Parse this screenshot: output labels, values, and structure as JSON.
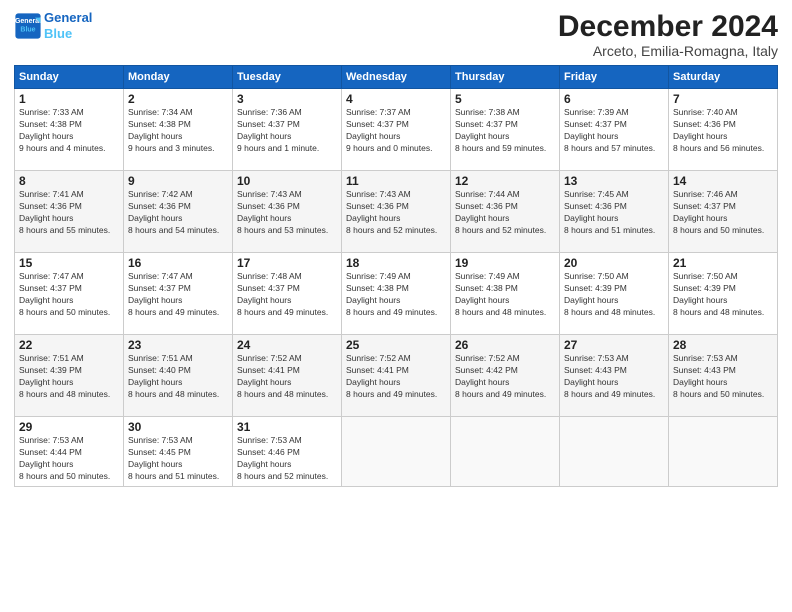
{
  "header": {
    "logo_line1": "General",
    "logo_line2": "Blue",
    "month": "December 2024",
    "location": "Arceto, Emilia-Romagna, Italy"
  },
  "days_of_week": [
    "Sunday",
    "Monday",
    "Tuesday",
    "Wednesday",
    "Thursday",
    "Friday",
    "Saturday"
  ],
  "weeks": [
    [
      {
        "day": "1",
        "sunrise": "7:33 AM",
        "sunset": "4:38 PM",
        "daylight": "9 hours and 4 minutes."
      },
      {
        "day": "2",
        "sunrise": "7:34 AM",
        "sunset": "4:38 PM",
        "daylight": "9 hours and 3 minutes."
      },
      {
        "day": "3",
        "sunrise": "7:36 AM",
        "sunset": "4:37 PM",
        "daylight": "9 hours and 1 minute."
      },
      {
        "day": "4",
        "sunrise": "7:37 AM",
        "sunset": "4:37 PM",
        "daylight": "9 hours and 0 minutes."
      },
      {
        "day": "5",
        "sunrise": "7:38 AM",
        "sunset": "4:37 PM",
        "daylight": "8 hours and 59 minutes."
      },
      {
        "day": "6",
        "sunrise": "7:39 AM",
        "sunset": "4:37 PM",
        "daylight": "8 hours and 57 minutes."
      },
      {
        "day": "7",
        "sunrise": "7:40 AM",
        "sunset": "4:36 PM",
        "daylight": "8 hours and 56 minutes."
      }
    ],
    [
      {
        "day": "8",
        "sunrise": "7:41 AM",
        "sunset": "4:36 PM",
        "daylight": "8 hours and 55 minutes."
      },
      {
        "day": "9",
        "sunrise": "7:42 AM",
        "sunset": "4:36 PM",
        "daylight": "8 hours and 54 minutes."
      },
      {
        "day": "10",
        "sunrise": "7:43 AM",
        "sunset": "4:36 PM",
        "daylight": "8 hours and 53 minutes."
      },
      {
        "day": "11",
        "sunrise": "7:43 AM",
        "sunset": "4:36 PM",
        "daylight": "8 hours and 52 minutes."
      },
      {
        "day": "12",
        "sunrise": "7:44 AM",
        "sunset": "4:36 PM",
        "daylight": "8 hours and 52 minutes."
      },
      {
        "day": "13",
        "sunrise": "7:45 AM",
        "sunset": "4:36 PM",
        "daylight": "8 hours and 51 minutes."
      },
      {
        "day": "14",
        "sunrise": "7:46 AM",
        "sunset": "4:37 PM",
        "daylight": "8 hours and 50 minutes."
      }
    ],
    [
      {
        "day": "15",
        "sunrise": "7:47 AM",
        "sunset": "4:37 PM",
        "daylight": "8 hours and 50 minutes."
      },
      {
        "day": "16",
        "sunrise": "7:47 AM",
        "sunset": "4:37 PM",
        "daylight": "8 hours and 49 minutes."
      },
      {
        "day": "17",
        "sunrise": "7:48 AM",
        "sunset": "4:37 PM",
        "daylight": "8 hours and 49 minutes."
      },
      {
        "day": "18",
        "sunrise": "7:49 AM",
        "sunset": "4:38 PM",
        "daylight": "8 hours and 49 minutes."
      },
      {
        "day": "19",
        "sunrise": "7:49 AM",
        "sunset": "4:38 PM",
        "daylight": "8 hours and 48 minutes."
      },
      {
        "day": "20",
        "sunrise": "7:50 AM",
        "sunset": "4:39 PM",
        "daylight": "8 hours and 48 minutes."
      },
      {
        "day": "21",
        "sunrise": "7:50 AM",
        "sunset": "4:39 PM",
        "daylight": "8 hours and 48 minutes."
      }
    ],
    [
      {
        "day": "22",
        "sunrise": "7:51 AM",
        "sunset": "4:39 PM",
        "daylight": "8 hours and 48 minutes."
      },
      {
        "day": "23",
        "sunrise": "7:51 AM",
        "sunset": "4:40 PM",
        "daylight": "8 hours and 48 minutes."
      },
      {
        "day": "24",
        "sunrise": "7:52 AM",
        "sunset": "4:41 PM",
        "daylight": "8 hours and 48 minutes."
      },
      {
        "day": "25",
        "sunrise": "7:52 AM",
        "sunset": "4:41 PM",
        "daylight": "8 hours and 49 minutes."
      },
      {
        "day": "26",
        "sunrise": "7:52 AM",
        "sunset": "4:42 PM",
        "daylight": "8 hours and 49 minutes."
      },
      {
        "day": "27",
        "sunrise": "7:53 AM",
        "sunset": "4:43 PM",
        "daylight": "8 hours and 49 minutes."
      },
      {
        "day": "28",
        "sunrise": "7:53 AM",
        "sunset": "4:43 PM",
        "daylight": "8 hours and 50 minutes."
      }
    ],
    [
      {
        "day": "29",
        "sunrise": "7:53 AM",
        "sunset": "4:44 PM",
        "daylight": "8 hours and 50 minutes."
      },
      {
        "day": "30",
        "sunrise": "7:53 AM",
        "sunset": "4:45 PM",
        "daylight": "8 hours and 51 minutes."
      },
      {
        "day": "31",
        "sunrise": "7:53 AM",
        "sunset": "4:46 PM",
        "daylight": "8 hours and 52 minutes."
      },
      null,
      null,
      null,
      null
    ]
  ],
  "labels": {
    "sunrise": "Sunrise:",
    "sunset": "Sunset:",
    "daylight": "Daylight hours"
  }
}
